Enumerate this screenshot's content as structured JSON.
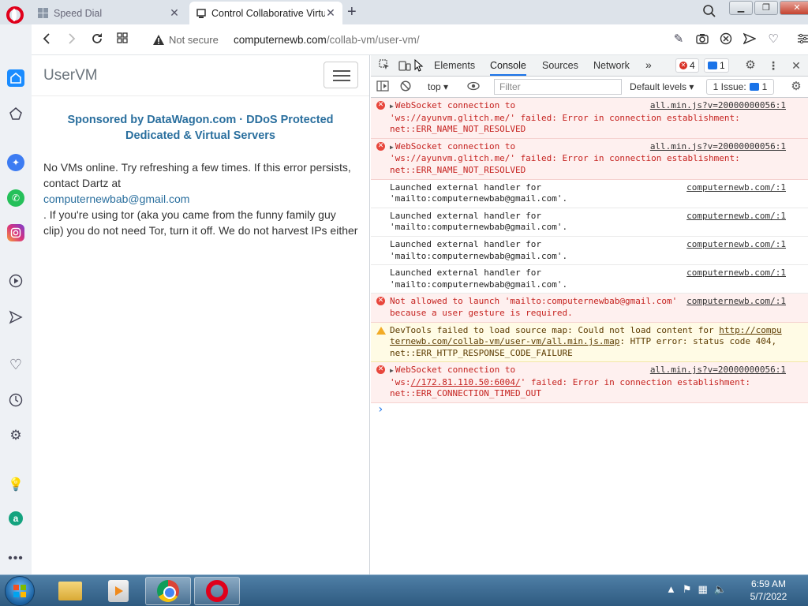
{
  "browser": {
    "tabs": [
      {
        "title": "Speed Dial",
        "active": false
      },
      {
        "title": "Control Collaborative Virtu",
        "active": true
      }
    ],
    "security_label": "Not secure",
    "url_host": "computernewb.com",
    "url_path": "/collab-vm/user-vm/"
  },
  "page": {
    "brand": "UserVM",
    "sponsor": "Sponsored by DataWagon.com · DDoS Protected Dedicated & Virtual Servers",
    "message_1": "No VMs online. Try refreshing a few times. If this error persists, contact Dartz at",
    "email": "computernewbab@gmail.com",
    "message_2": ". If you're using tor (aka you came from the funny family guy clip) you do not need Tor, turn it off. We do not harvest IPs either"
  },
  "devtools": {
    "tabs": [
      "Elements",
      "Console",
      "Sources",
      "Network"
    ],
    "more": "»",
    "error_count": "4",
    "message_count": "1",
    "context": "top",
    "filter_placeholder": "Filter",
    "levels": "Default levels",
    "issues_label": "1 Issue:",
    "issues_count": "1",
    "messages": [
      {
        "level": "error",
        "expandable": true,
        "text_a": "WebSocket connection to 'ws://ayunvm.glitch.me/' failed: Error in connection establishment: net::ERR_NAME_NOT_RESOLVED",
        "source": "all.min.js?v=20000000056:1"
      },
      {
        "level": "error",
        "expandable": true,
        "text_a": "WebSocket connection to 'ws://ayunvm.glitch.me/' failed: Error in connection establishment: net::ERR_NAME_NOT_RESOLVED",
        "source": "all.min.js?v=20000000056:1"
      },
      {
        "level": "info",
        "expandable": false,
        "text_a": "Launched external handler for 'mailto:computernewbab@gmail.com'.",
        "source": "computernewb.com/:1"
      },
      {
        "level": "info",
        "expandable": false,
        "text_a": "Launched external handler for 'mailto:computernewbab@gmail.com'.",
        "source": "computernewb.com/:1"
      },
      {
        "level": "info",
        "expandable": false,
        "text_a": "Launched external handler for 'mailto:computernewbab@gmail.com'.",
        "source": "computernewb.com/:1"
      },
      {
        "level": "info",
        "expandable": false,
        "text_a": "Launched external handler for 'mailto:computernewbab@gmail.com'.",
        "source": "computernewb.com/:1"
      },
      {
        "level": "error",
        "expandable": false,
        "text_a": "Not allowed to launch 'mailto:computernewbab@gmail.com' because a user gesture is required.",
        "source": "computernewb.com/:1"
      },
      {
        "level": "warn",
        "expandable": false,
        "text_a": "DevTools failed to load source map: Could not load content for ",
        "link": "http://computernewb.com/collab-vm/user-vm/all.min.js.map",
        "text_b": ": HTTP error: status code 404, net::ERR_HTTP_RESPONSE_CODE_FAILURE",
        "source": ""
      },
      {
        "level": "error",
        "expandable": true,
        "text_a": "WebSocket connection to 'ws:",
        "link": "//172.81.110.50:6004/",
        "text_b": "' failed: Error in connection establishment: net::ERR_CONNECTION_TIMED_OUT",
        "source": "all.min.js?v=20000000056:1"
      }
    ],
    "prompt": "›"
  },
  "taskbar": {
    "time": "6:59 AM",
    "date": "5/7/2022"
  }
}
